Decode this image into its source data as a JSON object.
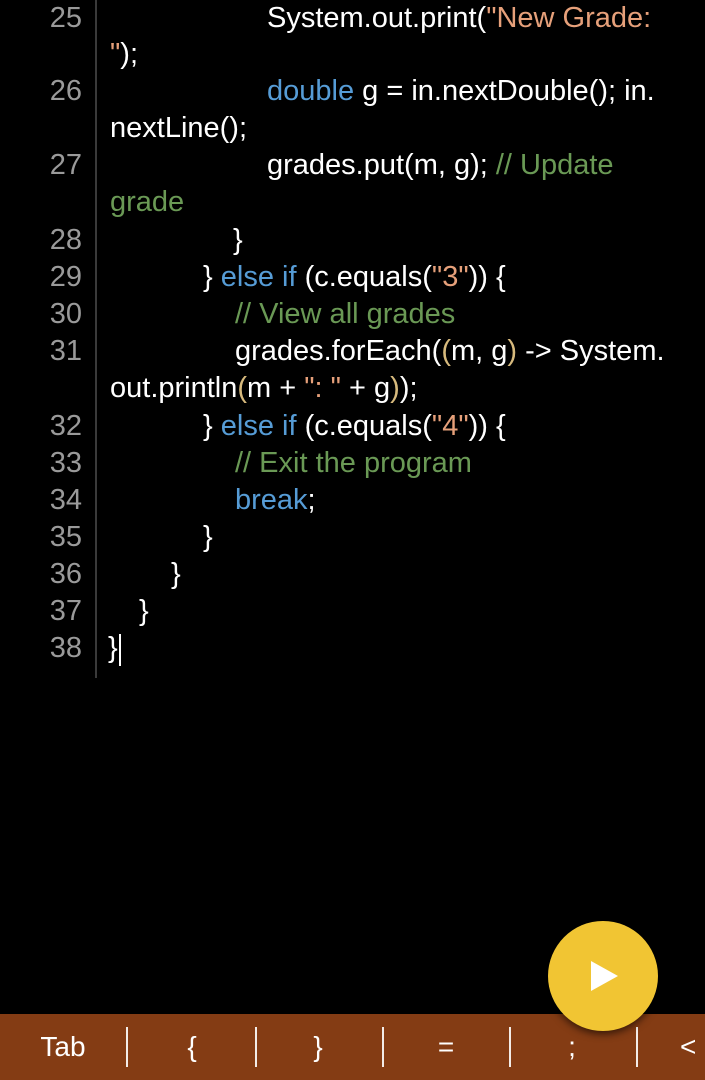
{
  "editor": {
    "line_numbers": [
      "25",
      "26",
      "27",
      "28",
      "29",
      "30",
      "31",
      "32",
      "33",
      "34",
      "35",
      "36",
      "37",
      "38"
    ],
    "lines": {
      "l25a_pre": "System.out.print(",
      "l25a_str": "\"New Grade:",
      "l25b_str": "\"",
      "l25b_post": ");",
      "l26a_kw": "double",
      "l26a_post": " g = in.nextDouble(); in.",
      "l26b": "nextLine();",
      "l27a_pre": "grades.put(m, g); ",
      "l27a_cm": "// Update",
      "l27b_cm": "grade",
      "l28": "}",
      "l29_pre": "} ",
      "l29_kw": "else if",
      "l29_mid": " (c.equals(",
      "l29_str": "\"3\"",
      "l29_post": ")) {",
      "l30_cm": "// View all grades",
      "l31a_pre": "grades.forEach(",
      "l31a_br": "(",
      "l31a_mid": "m, g",
      "l31a_br2": ")",
      "l31a_post": " -> System.",
      "l31b_pre": "out.println",
      "l31b_br": "(",
      "l31b_mid": "m + ",
      "l31b_str": "\": \"",
      "l31b_mid2": " + g",
      "l31b_br2": ")",
      "l31b_post": ");",
      "l32_pre": "} ",
      "l32_kw": "else if",
      "l32_mid": " (c.equals(",
      "l32_str": "\"4\"",
      "l32_post": ")) {",
      "l33_cm": "// Exit the program",
      "l34_kw": "break",
      "l34_post": ";",
      "l35": "}",
      "l36": "}",
      "l37": "}",
      "l38": "}"
    }
  },
  "run_button": {
    "icon": "play-icon"
  },
  "keybar": {
    "keys": [
      "Tab",
      "{",
      "}",
      "=",
      ";",
      "<"
    ]
  },
  "colors": {
    "background": "#000000",
    "keyword": "#569cd6",
    "string": "#e6a07a",
    "comment": "#6a9955",
    "bracket": "#d7ba7d",
    "fab": "#f1c533",
    "keybar": "#843c14"
  }
}
